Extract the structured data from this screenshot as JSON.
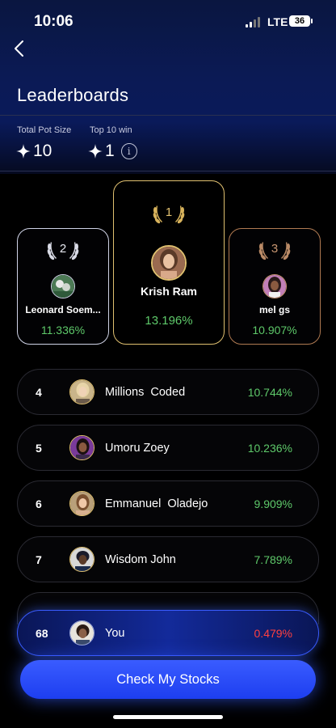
{
  "status_bar": {
    "time": "10:06",
    "network": "LTE",
    "battery": "36"
  },
  "header": {
    "title": "Leaderboards"
  },
  "stats": {
    "pot": {
      "label": "Total Pot Size",
      "value": "10"
    },
    "top10": {
      "label": "Top 10 win",
      "value": "1"
    }
  },
  "podium": [
    {
      "rank": "2",
      "name": "Leonard Soem...",
      "pct": "11.336%"
    },
    {
      "rank": "1",
      "name": "Krish Ram",
      "pct": "13.196%"
    },
    {
      "rank": "3",
      "name": "mel gs",
      "pct": "10.907%"
    }
  ],
  "rows": [
    {
      "rank": "4",
      "name": "Millions  Coded",
      "pct": "10.744%"
    },
    {
      "rank": "5",
      "name": "Umoru Zoey",
      "pct": "10.236%"
    },
    {
      "rank": "6",
      "name": "Emmanuel  Oladejo",
      "pct": "9.909%"
    },
    {
      "rank": "7",
      "name": "Wisdom John",
      "pct": "7.789%"
    }
  ],
  "me": {
    "rank": "68",
    "name": "You",
    "pct": "0.479%"
  },
  "cta": {
    "label": "Check My Stocks"
  },
  "colors": {
    "positive": "#5ec96a",
    "negative": "#ff4040",
    "accent": "#2a4cff",
    "gold": "#e0c070"
  }
}
